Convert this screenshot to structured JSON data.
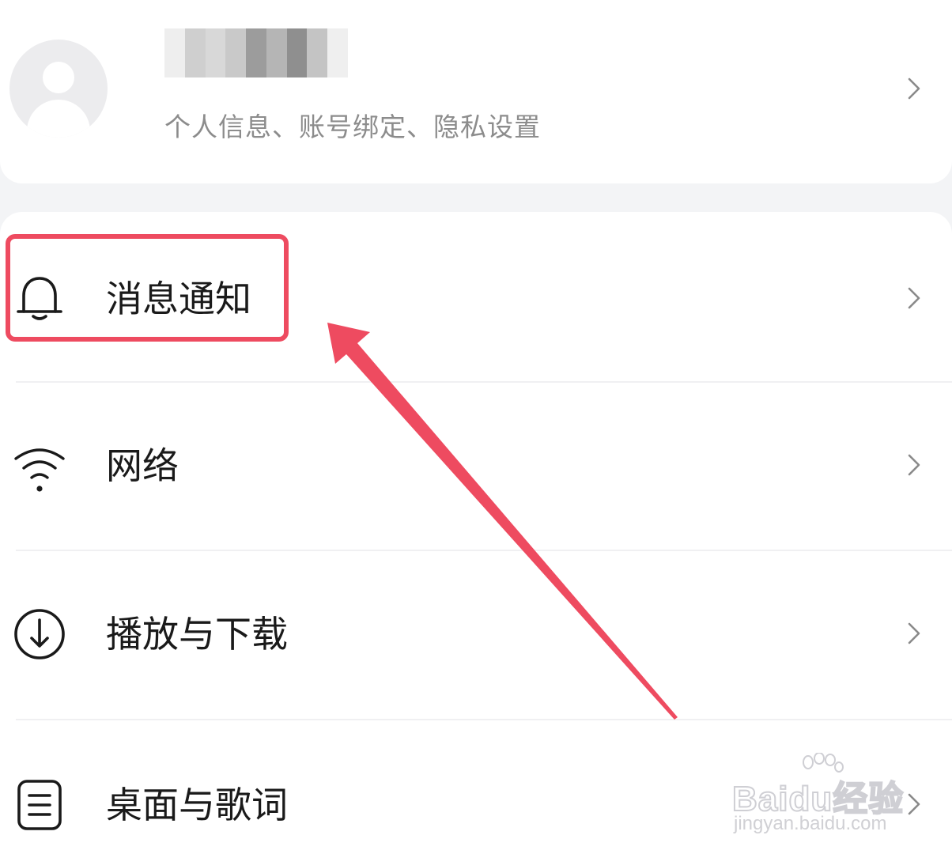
{
  "profile": {
    "subtitle": "个人信息、账号绑定、隐私设置",
    "name_blur_colors": [
      "#eeeeee",
      "#cfcfcf",
      "#d8d8d8",
      "#c9c9c9",
      "#9c9c9c",
      "#b5b5b5",
      "#8f8f8f",
      "#c4c4c4",
      "#efefef"
    ]
  },
  "menu": {
    "items": [
      {
        "label": "消息通知",
        "icon": "bell-icon"
      },
      {
        "label": "网络",
        "icon": "wifi-icon"
      },
      {
        "label": "播放与下载",
        "icon": "download-circle-icon"
      },
      {
        "label": "桌面与歌词",
        "icon": "lyrics-note-icon"
      }
    ]
  },
  "annotation": {
    "color": "#ee4b60"
  },
  "watermark": {
    "main": "Baidu经验",
    "sub": "jingyan.baidu.com"
  }
}
